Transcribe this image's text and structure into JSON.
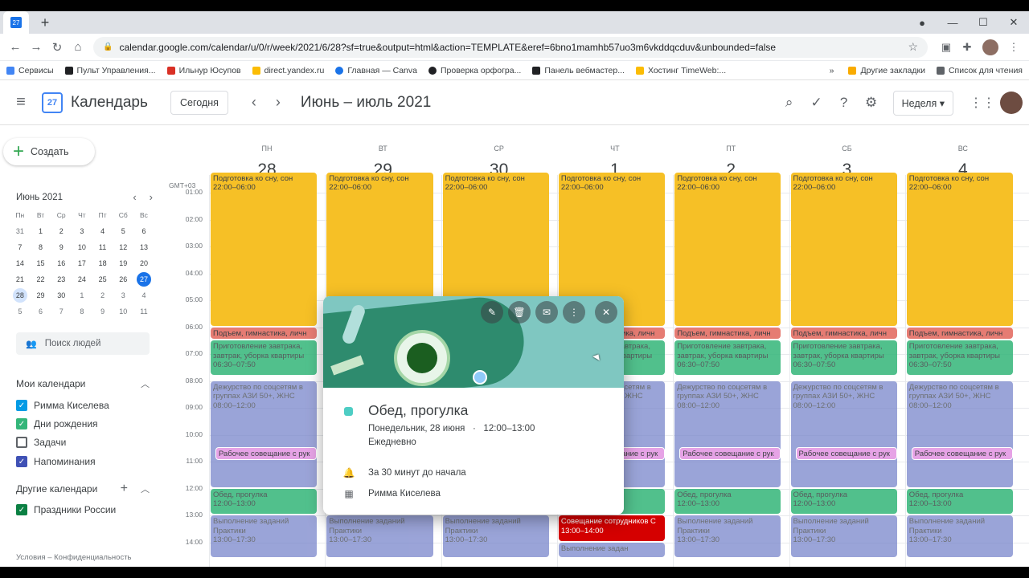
{
  "browser": {
    "url": "calendar.google.com/calendar/u/0/r/week/2021/6/28?sf=true&output=html&action=TEMPLATE&eref=6bno1mamhb57uo3m6vkddqcduv&unbounded=false",
    "bookmarks": [
      {
        "label": "Сервисы",
        "color": "#4285f4"
      },
      {
        "label": "Пульт Управления...",
        "color": "#202124"
      },
      {
        "label": "Ильнур Юсупов",
        "color": "#d93025"
      },
      {
        "label": "direct.yandex.ru",
        "color": "#fbbc04"
      },
      {
        "label": "Главная — Canva",
        "color": "#1a73e8"
      },
      {
        "label": "Проверка орфогра...",
        "color": "#202124"
      },
      {
        "label": "Панель вебмастер...",
        "color": "#202124"
      },
      {
        "label": "Хостинг TimeWeb:...",
        "color": "#fbbc04"
      }
    ],
    "bookmarks_more": "»",
    "other_bookmarks": "Другие закладки",
    "reading_list": "Список для чтения"
  },
  "header": {
    "app_title": "Календарь",
    "logo_day": "27",
    "today_button": "Сегодня",
    "period": "Июнь – июль 2021",
    "view_button": "Неделя"
  },
  "sidebar": {
    "create_label": "Создать",
    "mini_month": "Июнь 2021",
    "mini_dows": [
      "Пн",
      "Вт",
      "Ср",
      "Чт",
      "Пт",
      "Сб",
      "Вс"
    ],
    "mini_weeks": [
      [
        "31",
        "1",
        "2",
        "3",
        "4",
        "5",
        "6"
      ],
      [
        "7",
        "8",
        "9",
        "10",
        "11",
        "12",
        "13"
      ],
      [
        "14",
        "15",
        "16",
        "17",
        "18",
        "19",
        "20"
      ],
      [
        "21",
        "22",
        "23",
        "24",
        "25",
        "26",
        "27"
      ],
      [
        "28",
        "29",
        "30",
        "1",
        "2",
        "3",
        "4"
      ],
      [
        "5",
        "6",
        "7",
        "8",
        "9",
        "10",
        "11"
      ]
    ],
    "people_search": "Поиск людей",
    "my_calendars_title": "Мои календари",
    "my_calendars": [
      {
        "label": "Римма Киселева",
        "color": "#039be5",
        "checked": true
      },
      {
        "label": "Дни рождения",
        "color": "#33b679",
        "checked": true
      },
      {
        "label": "Задачи",
        "color": "#5f6368",
        "checked": false
      },
      {
        "label": "Напоминания",
        "color": "#3f51b5",
        "checked": true
      }
    ],
    "other_calendars_title": "Другие календари",
    "other_calendars": [
      {
        "label": "Праздники России",
        "color": "#0b8043",
        "checked": true
      }
    ],
    "footer": "Условия – Конфиденциальность"
  },
  "grid": {
    "timezone": "GMT+03",
    "days": [
      {
        "dow": "ПН",
        "num": "28"
      },
      {
        "dow": "ВТ",
        "num": "29"
      },
      {
        "dow": "СР",
        "num": "30"
      },
      {
        "dow": "ЧТ",
        "num": "1"
      },
      {
        "dow": "ПТ",
        "num": "2"
      },
      {
        "dow": "СБ",
        "num": "3"
      },
      {
        "dow": "ВС",
        "num": "4"
      }
    ],
    "hours": [
      "01:00",
      "02:00",
      "03:00",
      "04:00",
      "05:00",
      "06:00",
      "07:00",
      "08:00",
      "09:00",
      "10:00",
      "11:00",
      "12:00",
      "13:00",
      "14:00"
    ],
    "events": {
      "sleep": {
        "title": "Подготовка ко сну, сон",
        "time": "22:00–06:00"
      },
      "wake": {
        "title": "Подъем, гимнастика, личн"
      },
      "breakfast": {
        "title": "Приготовление завтрака, завтрак, уборка квартиры",
        "time": "06:30–07:50"
      },
      "duty": {
        "title": "Дежурство по соцсетям в группах АЗИ 50+, ЖНС",
        "time": "08:00–12:00"
      },
      "meet": {
        "title": "Рабочее совещание с рук"
      },
      "lunch": {
        "title": "Обед, прогулка",
        "time": "12:00–13:00"
      },
      "tasks": {
        "title": "Выполнение заданий Практики",
        "time": "13:00–17:30"
      },
      "staff": {
        "title": "Совещание сотрудников С",
        "time": "13:00–14:00"
      },
      "tasks_partial": {
        "title": "Выполнение задан"
      }
    }
  },
  "popup": {
    "title": "Обед, прогулка",
    "date": "Понедельник, 28 июня",
    "separator": "·",
    "time": "12:00–13:00",
    "recurrence": "Ежедневно",
    "reminder": "За 30 минут до начала",
    "calendar": "Римма Киселева",
    "swatch_color": "#4ecdc4"
  }
}
